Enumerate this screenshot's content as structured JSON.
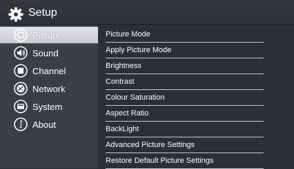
{
  "header": {
    "title": "Setup",
    "icon": "gear-icon"
  },
  "sidebar": {
    "items": [
      {
        "label": "Picture",
        "icon": "picture-icon",
        "selected": true
      },
      {
        "label": "Sound",
        "icon": "speaker-icon",
        "selected": false
      },
      {
        "label": "Channel",
        "icon": "channel-icon",
        "selected": false
      },
      {
        "label": "Network",
        "icon": "network-icon",
        "selected": false
      },
      {
        "label": "System",
        "icon": "system-icon",
        "selected": false
      },
      {
        "label": "About",
        "icon": "info-icon",
        "selected": false
      }
    ]
  },
  "menu": {
    "items": [
      "Picture Mode",
      "Apply Picture Mode",
      "Brightness",
      "Contrast",
      "Colour Saturation",
      "Aspect Ratio",
      "BackLight",
      "Advanced Picture Settings",
      "Restore Default Picture Settings"
    ]
  },
  "colors": {
    "background": "#2b2f36",
    "sidebar": "#3a3f46",
    "selected": "#d6d7da",
    "text": "#ffffff"
  }
}
